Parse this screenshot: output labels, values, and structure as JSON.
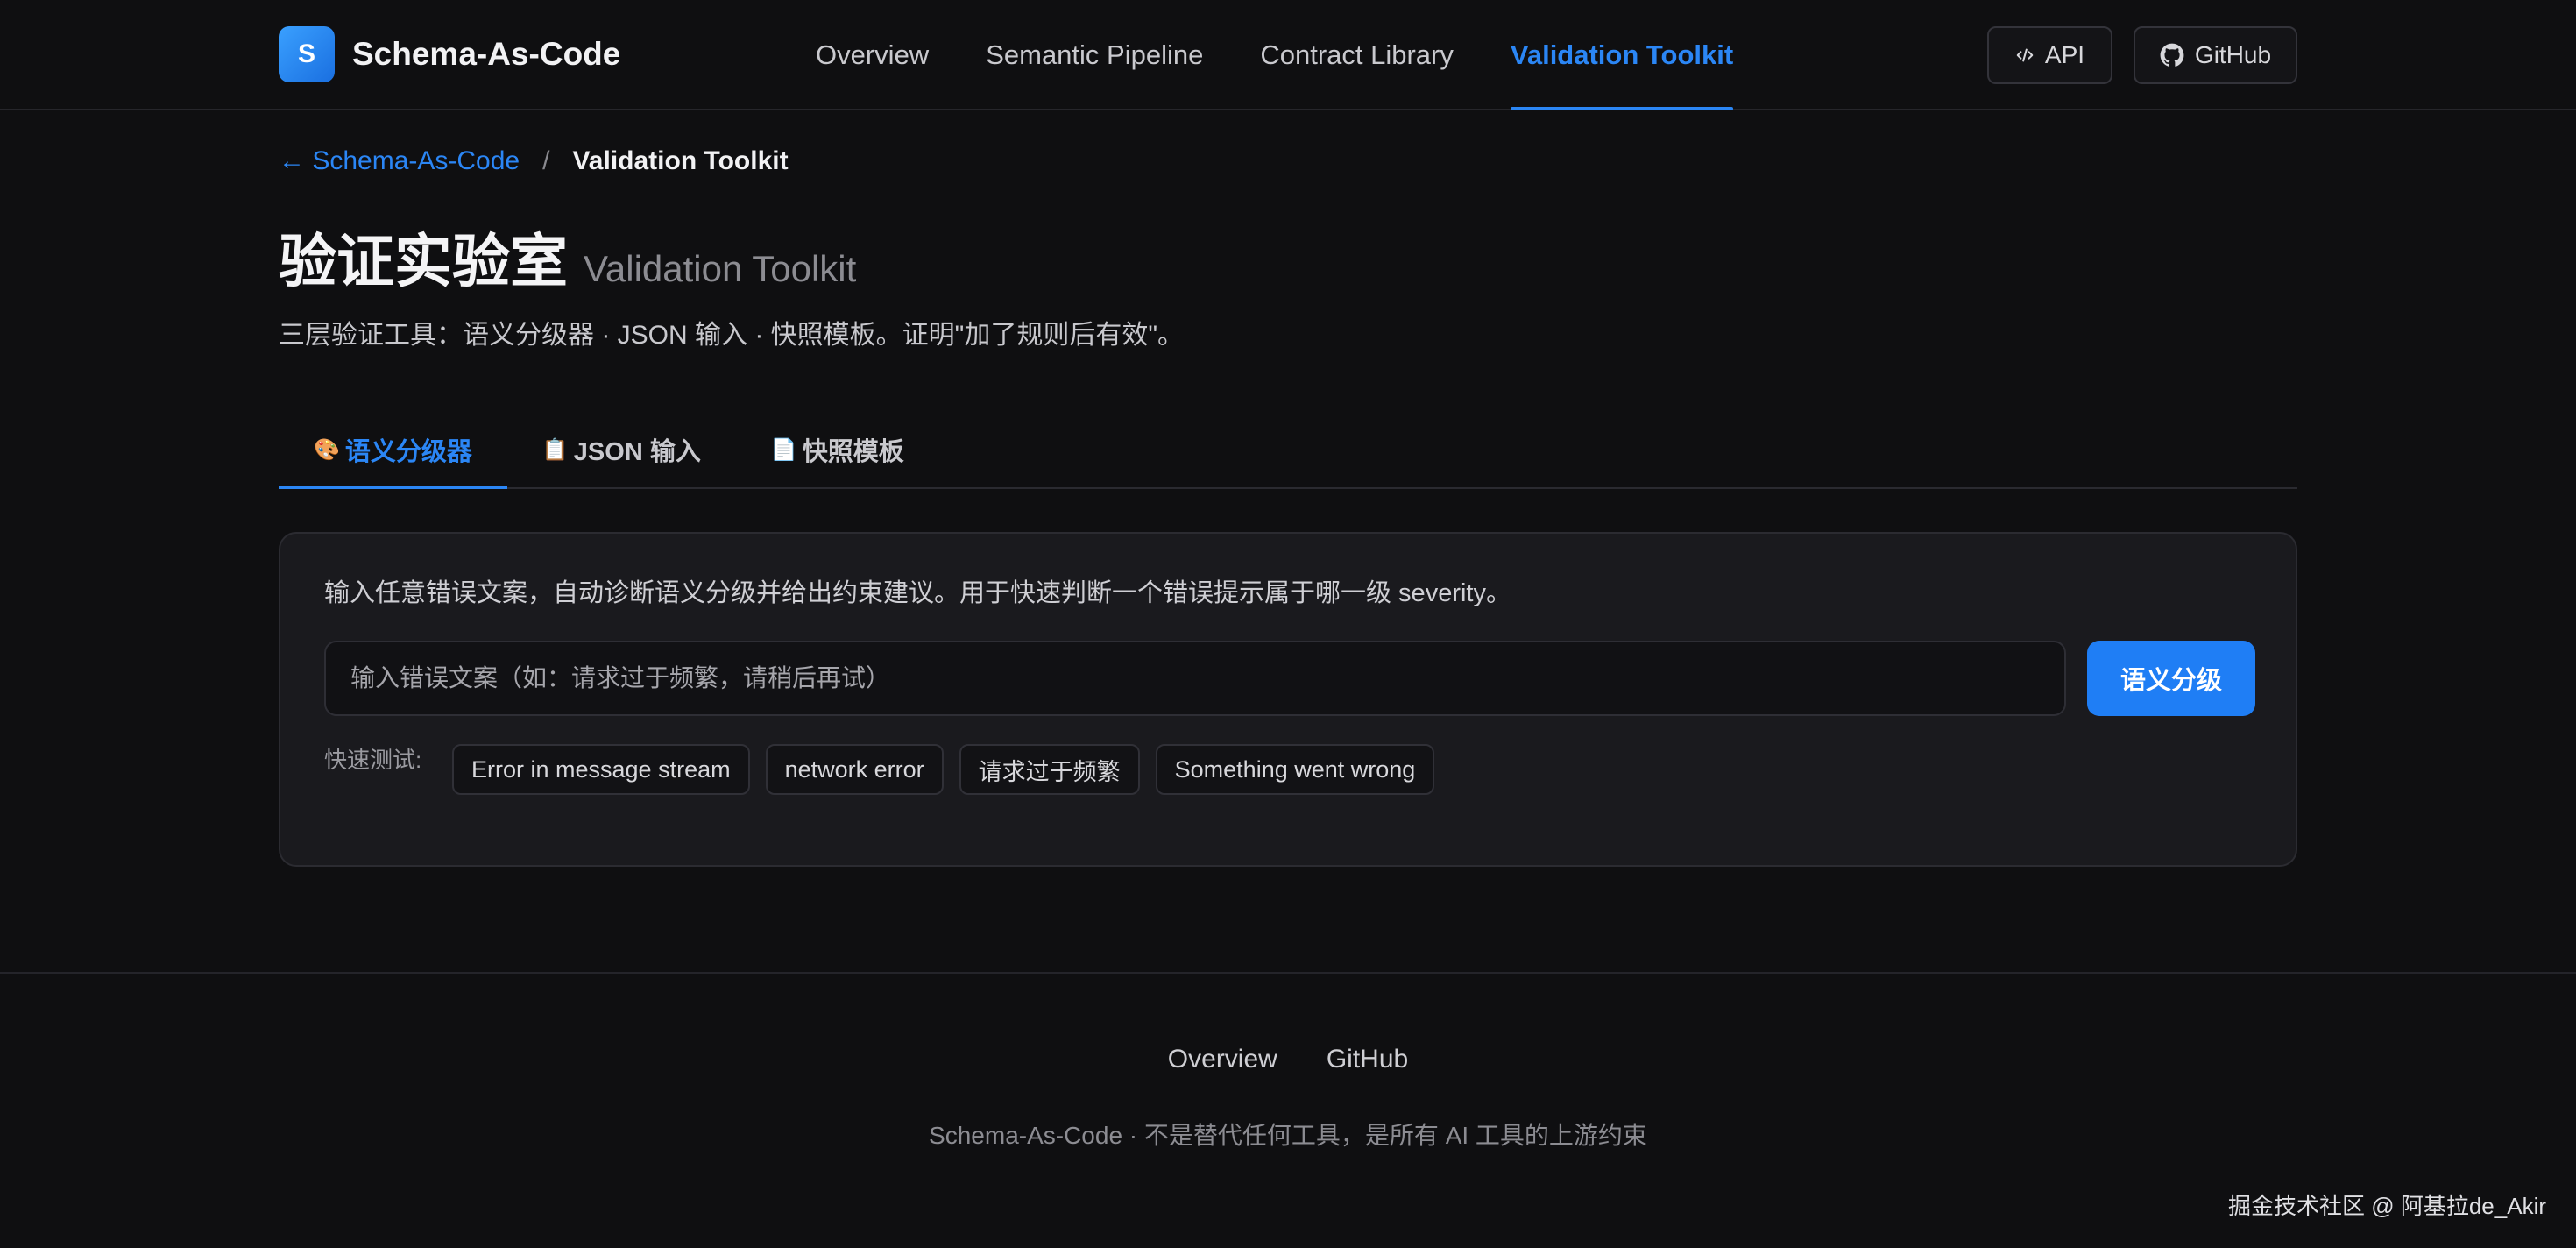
{
  "header": {
    "logo_letter": "S",
    "brand": "Schema-As-Code",
    "nav": [
      {
        "label": "Overview"
      },
      {
        "label": "Semantic Pipeline"
      },
      {
        "label": "Contract Library"
      },
      {
        "label": "Validation Toolkit",
        "active": true
      }
    ],
    "api_label": "API",
    "github_label": "GitHub"
  },
  "breadcrumb": {
    "back_label": "← Schema-As-Code",
    "separator": "/",
    "current": "Validation Toolkit"
  },
  "page": {
    "title_cn": "验证实验室",
    "title_en": "Validation Toolkit",
    "subtitle": "三层验证工具：语义分级器 · JSON 输入 · 快照模板。证明\"加了规则后有效\"。"
  },
  "tabs": [
    {
      "icon": "🎨",
      "label": "语义分级器",
      "active": true
    },
    {
      "icon": "📋",
      "label": "JSON 输入"
    },
    {
      "icon": "📄",
      "label": "快照模板"
    }
  ],
  "classifier": {
    "description": "输入任意错误文案，自动诊断语义分级并给出约束建议。用于快速判断一个错误提示属于哪一级 severity。",
    "input_value": "",
    "input_placeholder": "输入错误文案（如：请求过于频繁，请稍后再试）",
    "button_label": "语义分级",
    "quick_label": "快速测试:",
    "quick_tests": [
      "Error in message stream",
      "network error",
      "请求过于频繁",
      "Something went wrong"
    ]
  },
  "footer": {
    "links": [
      "Overview",
      "GitHub"
    ],
    "tagline": "Schema-As-Code · 不是替代任何工具，是所有 AI 工具的上游约束"
  },
  "watermark": "掘金技术社区 @ 阿基拉de_Akir",
  "colors": {
    "accent": "#2b86f5",
    "background": "#0f0f11",
    "card": "#1a1a1e"
  }
}
